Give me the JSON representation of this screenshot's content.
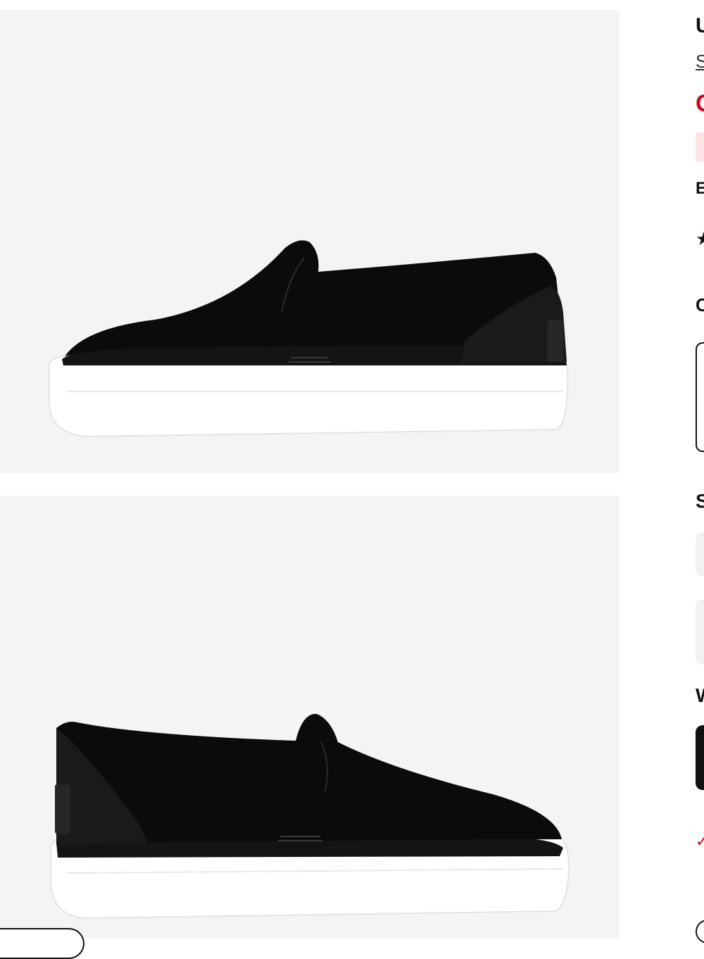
{
  "gallery": {
    "images": [
      {
        "alt": "Black slip-on platform sneaker, side view facing left",
        "view": "side-left"
      },
      {
        "alt": "Black slip-on platform sneaker, side view facing right",
        "view": "side-right"
      }
    ]
  },
  "product_panel": {
    "title_visible": "U",
    "subtitle_visible": "S",
    "price_visible": "C",
    "label_b": "E",
    "rating_icon": "star-icon",
    "color_heading": "C",
    "size_heading": "S",
    "width_heading": "W",
    "promo_icon": "promo-icon"
  },
  "colors": {
    "accent_red": "#d0021b",
    "badge_bg": "#fde3e3",
    "shoe_upper": "#0b0b0b",
    "sole": "#ffffff",
    "photo_bg": "#f4f4f4"
  }
}
